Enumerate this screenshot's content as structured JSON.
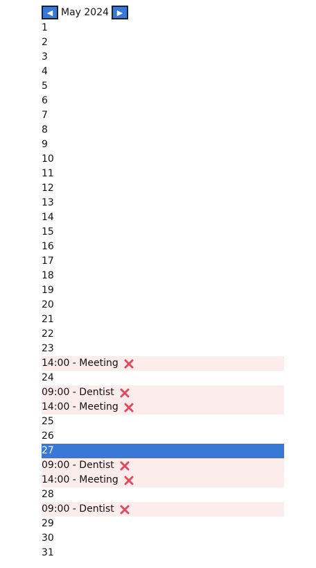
{
  "header": {
    "prev_icon": "triangle-left-icon",
    "next_icon": "triangle-right-icon",
    "month_label": "May 2024"
  },
  "colors": {
    "accent": "#3a78d8",
    "event_bg": "#fcecec",
    "delete": "#e04a5f"
  },
  "selected_day": "27",
  "days": [
    {
      "day": "1",
      "events": []
    },
    {
      "day": "2",
      "events": []
    },
    {
      "day": "3",
      "events": []
    },
    {
      "day": "4",
      "events": []
    },
    {
      "day": "5",
      "events": []
    },
    {
      "day": "6",
      "events": []
    },
    {
      "day": "7",
      "events": []
    },
    {
      "day": "8",
      "events": []
    },
    {
      "day": "9",
      "events": []
    },
    {
      "day": "10",
      "events": []
    },
    {
      "day": "11",
      "events": []
    },
    {
      "day": "12",
      "events": []
    },
    {
      "day": "13",
      "events": []
    },
    {
      "day": "14",
      "events": []
    },
    {
      "day": "15",
      "events": []
    },
    {
      "day": "16",
      "events": []
    },
    {
      "day": "17",
      "events": []
    },
    {
      "day": "18",
      "events": []
    },
    {
      "day": "19",
      "events": []
    },
    {
      "day": "20",
      "events": []
    },
    {
      "day": "21",
      "events": []
    },
    {
      "day": "22",
      "events": []
    },
    {
      "day": "23",
      "events": [
        "14:00 - Meeting"
      ]
    },
    {
      "day": "24",
      "events": [
        "09:00 - Dentist",
        "14:00 - Meeting"
      ]
    },
    {
      "day": "25",
      "events": []
    },
    {
      "day": "26",
      "events": []
    },
    {
      "day": "27",
      "events": [
        "09:00 - Dentist",
        "14:00 - Meeting"
      ]
    },
    {
      "day": "28",
      "events": [
        "09:00 - Dentist"
      ]
    },
    {
      "day": "29",
      "events": []
    },
    {
      "day": "30",
      "events": []
    },
    {
      "day": "31",
      "events": []
    }
  ]
}
